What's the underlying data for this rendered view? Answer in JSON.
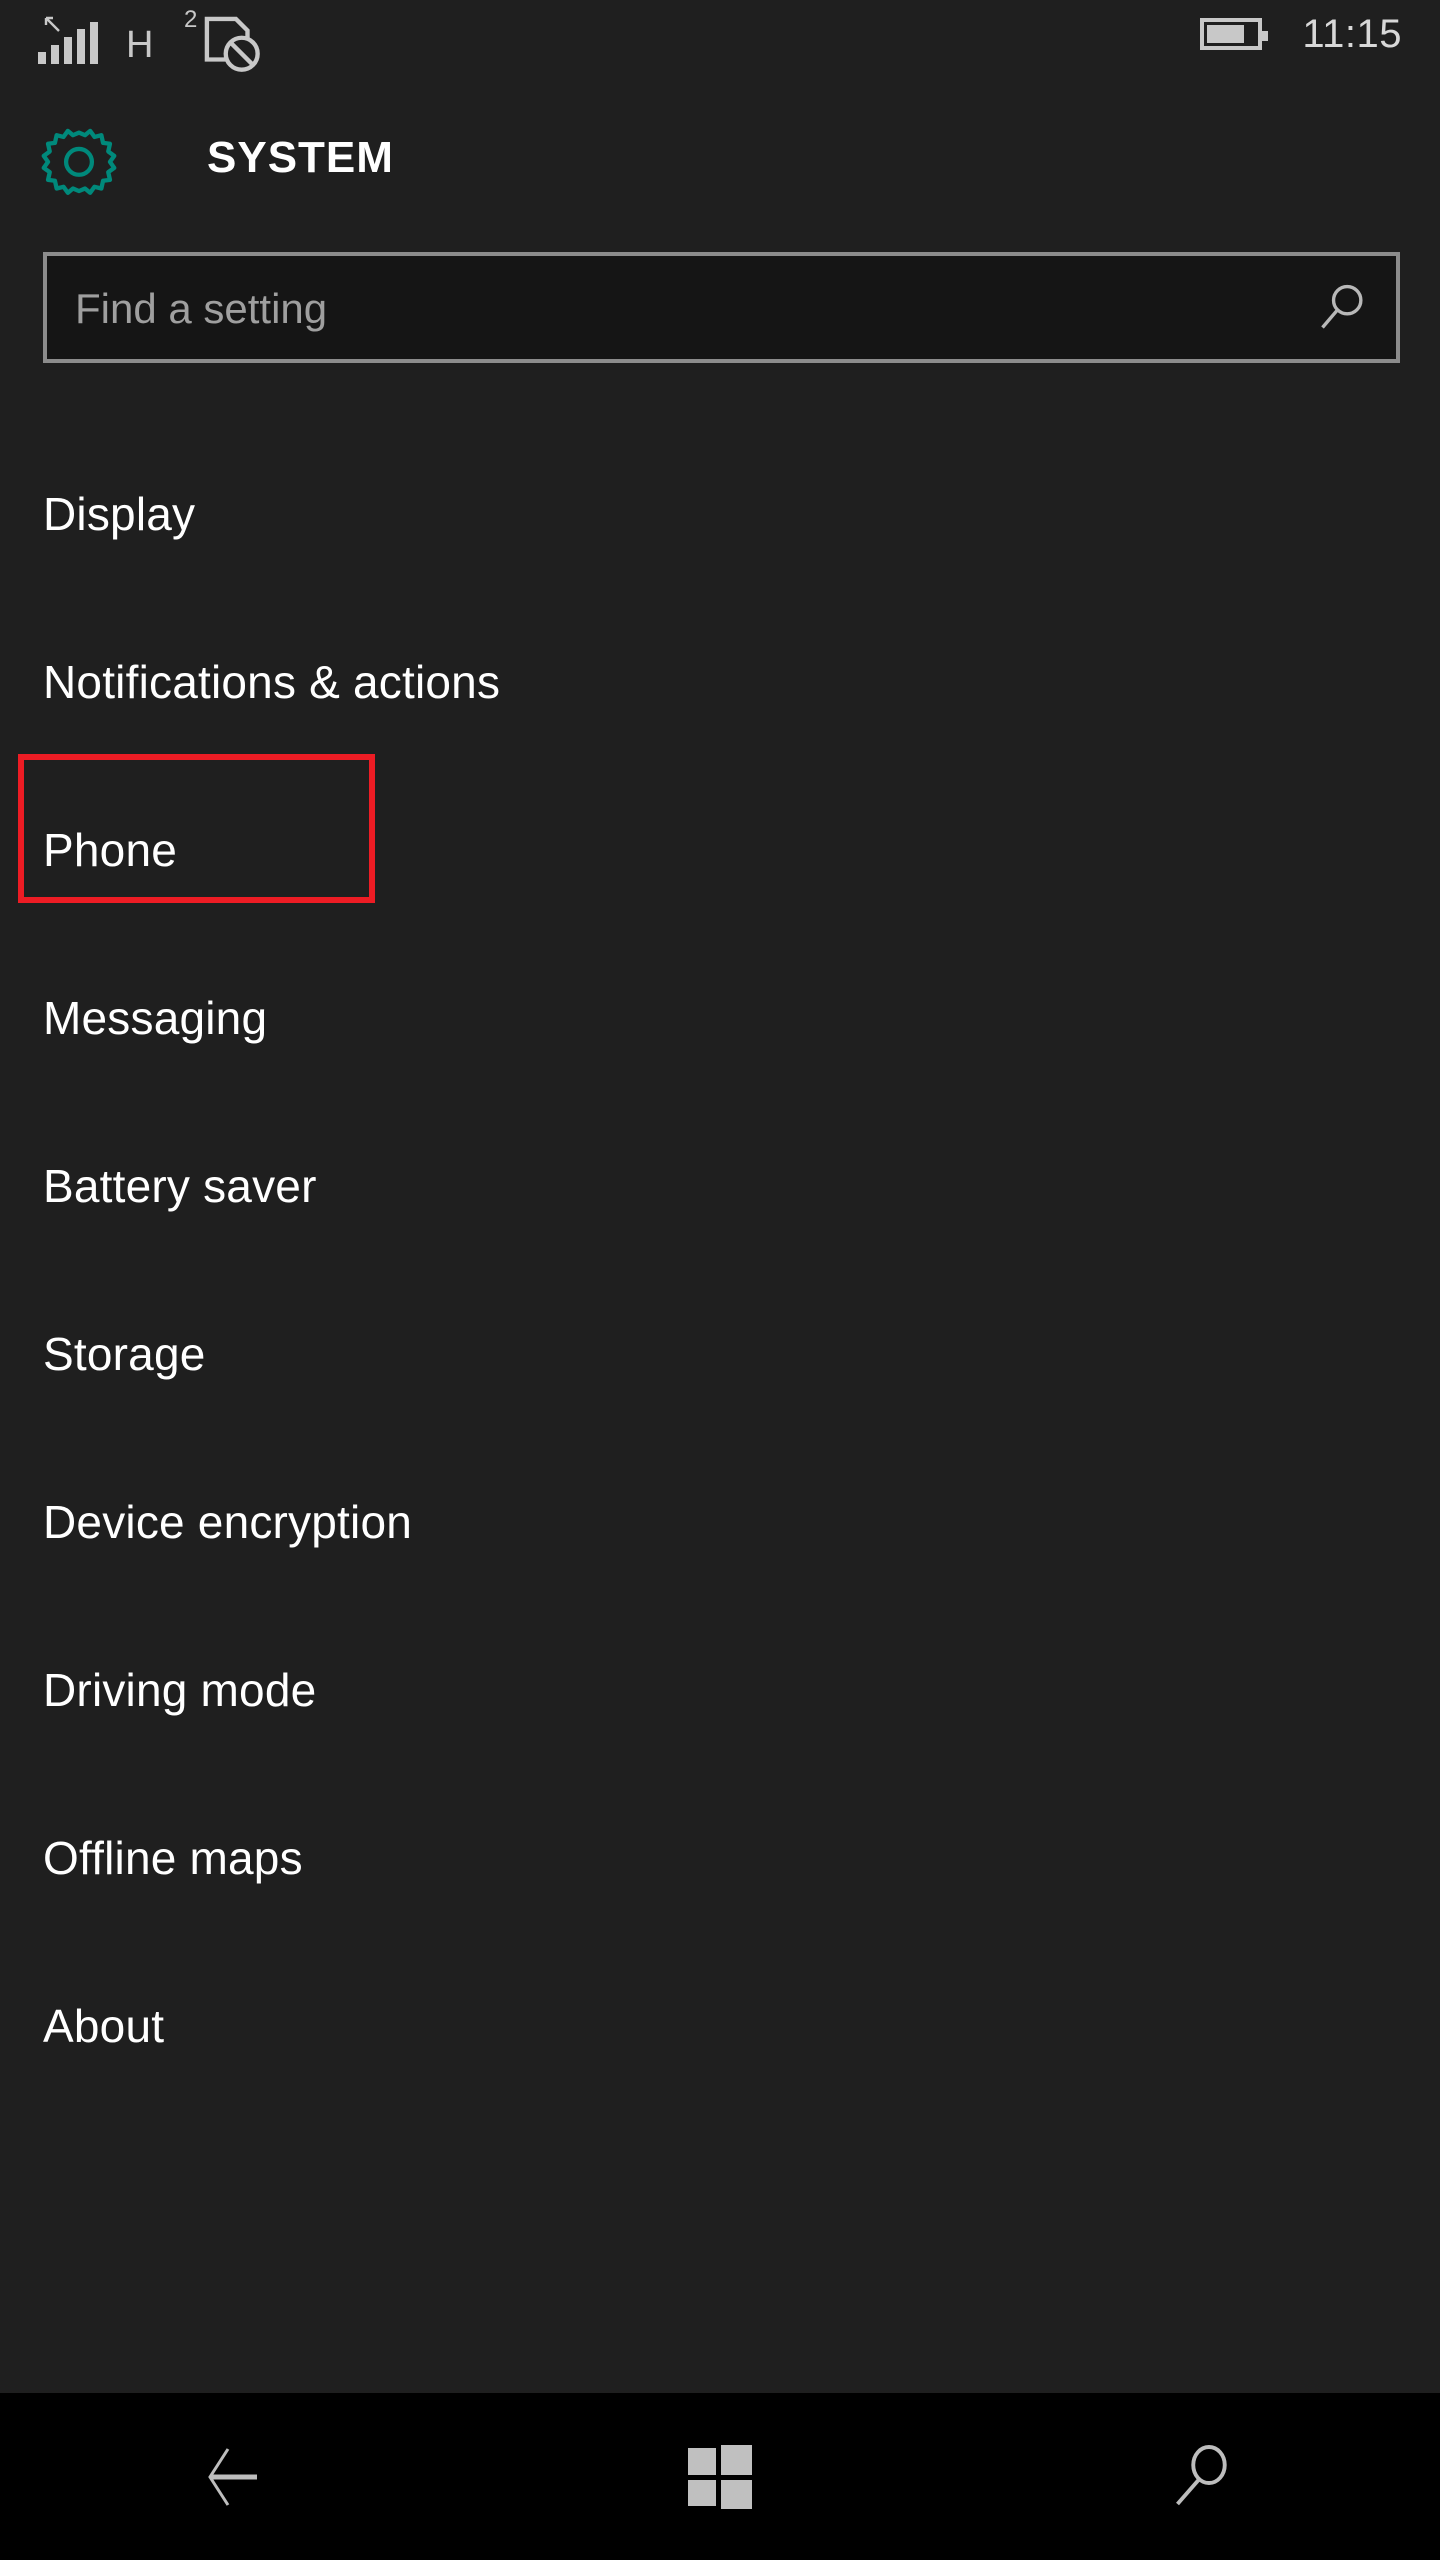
{
  "status_bar": {
    "signal_icon": "signal-bars-icon",
    "signal_bars": 5,
    "roaming_icon": "roaming-arrow-icon",
    "network_type": "H",
    "sim_slot_number": "2",
    "sim_icon": "sim-blocked-icon",
    "battery_icon": "battery-icon",
    "battery_level_percent": 70,
    "time": "11:15"
  },
  "header": {
    "icon": "gear-icon",
    "icon_color": "#00897B",
    "title": "SYSTEM"
  },
  "search": {
    "placeholder": "Find a setting",
    "value": "",
    "icon": "search-icon"
  },
  "settings_list": {
    "items": [
      {
        "label": "Display"
      },
      {
        "label": "Notifications & actions"
      },
      {
        "label": "Phone"
      },
      {
        "label": "Messaging"
      },
      {
        "label": "Battery saver"
      },
      {
        "label": "Storage"
      },
      {
        "label": "Device encryption"
      },
      {
        "label": "Driving mode"
      },
      {
        "label": "Offline maps"
      },
      {
        "label": "About"
      }
    ]
  },
  "annotation": {
    "target_label": "Phone",
    "color": "#ED1C24"
  },
  "nav_bar": {
    "back_icon": "back-arrow-icon",
    "home_icon": "windows-logo-icon",
    "search_icon": "search-icon"
  },
  "colors": {
    "page_background": "#1F1F1F",
    "nav_background": "#000000",
    "accent_teal": "#00897B",
    "text_primary": "#FFFFFF",
    "text_muted": "#9F9F9F",
    "highlight_red": "#ED1C24"
  }
}
